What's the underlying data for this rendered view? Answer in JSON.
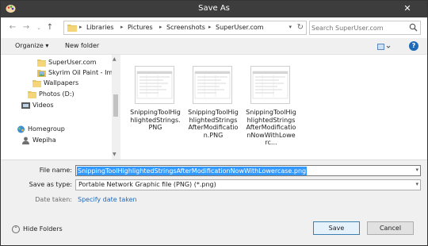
{
  "window": {
    "title": "Save As",
    "close_glyph": "✕"
  },
  "nav": {
    "back_glyph": "←",
    "forward_glyph": "→",
    "up_glyph": "↑",
    "recent_glyph": "⌄",
    "breadcrumbs": [
      "Libraries",
      "Pictures",
      "Screenshots",
      "SuperUser.com"
    ],
    "sep_glyph": "▸",
    "search_placeholder": "Search SuperUser.com"
  },
  "toolbar": {
    "organize_label": "Organize ▾",
    "new_folder_label": "New folder",
    "help_glyph": "?"
  },
  "navpane": {
    "items": [
      {
        "label": "SuperUser.com",
        "icon": "folder-icon"
      },
      {
        "label": "Skyrim Oil Paint - Img",
        "icon": "image-folder-icon"
      },
      {
        "label": "Wallpapers",
        "icon": "folder-icon"
      },
      {
        "label": "Photos (D:)",
        "icon": "folder-icon"
      },
      {
        "label": "Videos",
        "icon": "video-library-icon"
      },
      {
        "label": "Homegroup",
        "icon": "homegroup-icon"
      },
      {
        "label": "Wepiha",
        "icon": "user-icon"
      }
    ]
  },
  "files": [
    {
      "name": "SnippingToolHighlightedStrings.PNG"
    },
    {
      "name": "SnippingToolHighlightedStringsAfterModification.PNG"
    },
    {
      "name": "SnippingToolHighlightedStringsAfterModificationNowWithLowerc..."
    }
  ],
  "form": {
    "file_name_label": "File name:",
    "file_name_value": "SnippingToolHighlightedStringsAfterModificationNowWithLowercase.png",
    "save_type_label": "Save as type:",
    "save_type_value": "Portable Network Graphic file (PNG) (*.png)",
    "date_label": "Date taken:",
    "date_link": "Specify date taken"
  },
  "footer": {
    "hide_folders_label": "Hide Folders",
    "save_label": "Save",
    "cancel_label": "Cancel"
  },
  "colors": {
    "accent": "#3399ff",
    "titlebar": "#3d3d3d",
    "link": "#1f69b9"
  }
}
